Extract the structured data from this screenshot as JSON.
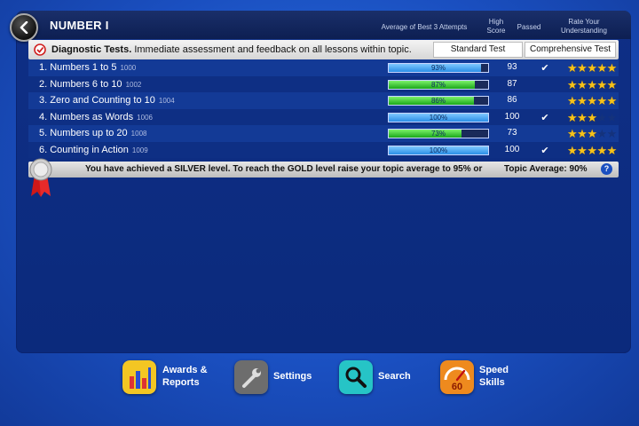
{
  "topic": {
    "title": "NUMBER I"
  },
  "headers": {
    "avg": "Average of Best 3 Attempts",
    "high_1": "High",
    "high_2": "Score",
    "passed": "Passed",
    "rate_1": "Rate Your",
    "rate_2": "Understanding"
  },
  "diagnostic": {
    "bold": "Diagnostic Tests.",
    "text": " Immediate assessment and feedback on all lessons within topic.",
    "standard_label": "Standard Test",
    "comprehensive_label": "Comprehensive Test"
  },
  "lessons": [
    {
      "name": "1. Numbers 1 to 5",
      "code": "1000",
      "avg": 93,
      "avg_label": "93%",
      "color": "blue",
      "high": "93",
      "passed": true,
      "stars": 5
    },
    {
      "name": "2. Numbers 6 to 10",
      "code": "1002",
      "avg": 87,
      "avg_label": "87%",
      "color": "green",
      "high": "87",
      "passed": false,
      "stars": 5
    },
    {
      "name": "3. Zero and Counting to 10",
      "code": "1004",
      "avg": 86,
      "avg_label": "86%",
      "color": "green",
      "high": "86",
      "passed": false,
      "stars": 5
    },
    {
      "name": "4. Numbers as Words",
      "code": "1006",
      "avg": 100,
      "avg_label": "100%",
      "color": "blue",
      "high": "100",
      "passed": true,
      "stars": 3
    },
    {
      "name": "5. Numbers up to 20",
      "code": "1008",
      "avg": 73,
      "avg_label": "73%",
      "color": "green",
      "high": "73",
      "passed": false,
      "stars": 3
    },
    {
      "name": "6. Counting in Action",
      "code": "1009",
      "avg": 100,
      "avg_label": "100%",
      "color": "blue",
      "high": "100",
      "passed": true,
      "stars": 5
    }
  ],
  "footer": {
    "message": "You have achieved a SILVER level. To reach the GOLD level raise your topic average to 95% or",
    "topic_average": "Topic Average: 90%",
    "help": "?"
  },
  "dock": {
    "awards_1": "Awards &",
    "awards_2": "Reports",
    "settings": "Settings",
    "search": "Search",
    "speed_1": "Speed",
    "speed_2": "Skills",
    "speed_badge": "60"
  },
  "colors": {
    "on_star": "#f6c21a",
    "off_star": "#14327c",
    "check": "✔"
  }
}
